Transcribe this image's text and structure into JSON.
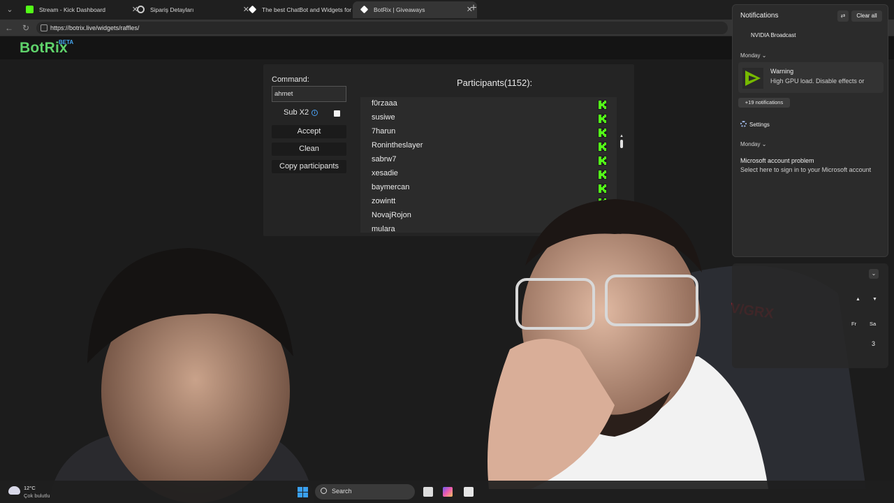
{
  "browser": {
    "tabs": [
      {
        "title": "Stream - Kick Dashboard",
        "active": false,
        "icon": "kick-icon",
        "color": "#53fc18"
      },
      {
        "title": "Sipariş Detayları",
        "active": false,
        "icon": "loader-icon",
        "color": "#cccccc"
      },
      {
        "title": "The best ChatBot and Widgets for",
        "active": false,
        "icon": "botrix-icon",
        "color": "#ffffff"
      },
      {
        "title": "BotRix | Giveaways",
        "active": true,
        "icon": "botrix-icon",
        "color": "#ffffff"
      }
    ],
    "new_tab_label": "+",
    "url": "https://botrix.live/widgets/raffles/"
  },
  "app": {
    "logo": "BotRix",
    "badge": "BETA",
    "brand_color": "#5fd36b"
  },
  "raffle": {
    "command_label": "Command:",
    "command_value": "ahmet",
    "sub_label": "Sub X2",
    "sub_checked": false,
    "buttons": {
      "accept": "Accept",
      "clean": "Clean",
      "copy": "Copy participants"
    },
    "participants_title": "Participants(1152):",
    "participants": [
      "f0rzaaa",
      "susiwe",
      "7harun",
      "Ronintheslayer",
      "sabrw7",
      "xesadie",
      "baymercan",
      "zowintt",
      "NovajRojon",
      "mulara"
    ]
  },
  "notifications": {
    "title": "Notifications",
    "clear_all": "Clear all",
    "app_header": "NVIDIA Broadcast",
    "group1_day": "Monday",
    "warning_title": "Warning",
    "warning_text": "High GPU load. Disable effects or",
    "more": "+19 notifications",
    "settings": "Settings",
    "group2_day": "Monday",
    "ms_title": "Microsoft account problem",
    "ms_text": "Select here to sign in to your Microsoft account"
  },
  "calendar": {
    "days": [
      "Fr",
      "Sa"
    ],
    "numbers": [
      "3"
    ]
  },
  "taskbar": {
    "temperature": "12°C",
    "weather": "Çok bulutlu",
    "search": "Search"
  }
}
